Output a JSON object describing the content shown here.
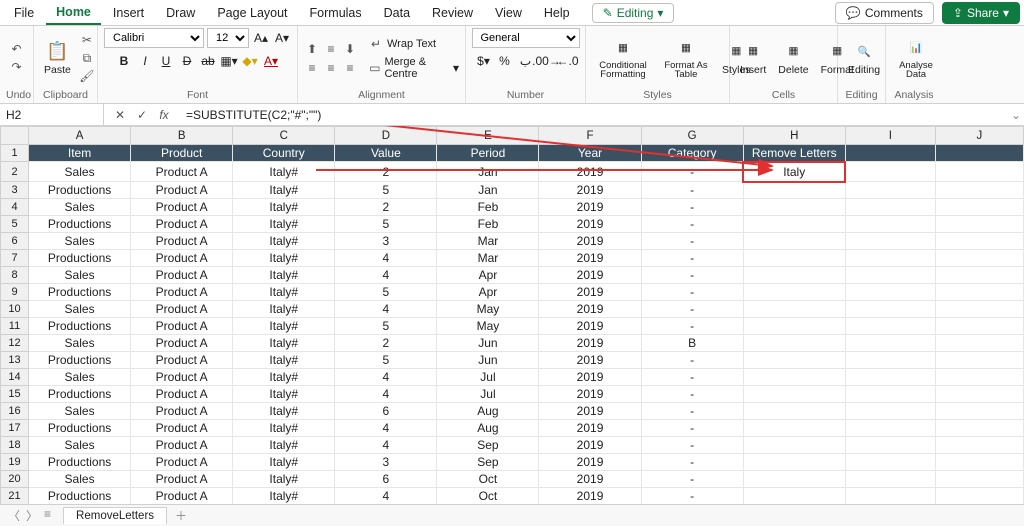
{
  "tabs": {
    "file": "File",
    "home": "Home",
    "insert": "Insert",
    "draw": "Draw",
    "layout": "Page Layout",
    "formulas": "Formulas",
    "data": "Data",
    "review": "Review",
    "view": "View",
    "help": "Help"
  },
  "editing_btn": "Editing",
  "comments_btn": "Comments",
  "share_btn": "Share",
  "ribbon": {
    "undo": "Undo",
    "paste": "Paste",
    "clipboard": "Clipboard",
    "font_name": "Calibri",
    "font_size": "12",
    "font_group": "Font",
    "wrap": "Wrap Text",
    "merge": "Merge & Centre",
    "align_group": "Alignment",
    "number_format": "General",
    "number_group": "Number",
    "cond": "Conditional Formatting",
    "fmt_tbl": "Format As Table",
    "styles": "Styles",
    "styles_group": "Styles",
    "insert": "Insert",
    "delete": "Delete",
    "format": "Format",
    "cells_group": "Cells",
    "editing": "Editing",
    "editing_group": "Editing",
    "analyse": "Analyse Data",
    "analysis_group": "Analysis"
  },
  "namebox": "H2",
  "formula": "=SUBSTITUTE(C2;\"#\";\"\")",
  "columns": [
    "A",
    "B",
    "C",
    "D",
    "E",
    "F",
    "G",
    "H",
    "I",
    "J"
  ],
  "headers": [
    "Item",
    "Product",
    "Country",
    "Value",
    "Period",
    "Year",
    "Category",
    "Remove Letters"
  ],
  "rows": [
    {
      "n": 1
    },
    {
      "n": 2,
      "c": [
        "Sales",
        "Product A",
        "Italy#",
        "2",
        "Jan",
        "2019",
        "-",
        "Italy"
      ]
    },
    {
      "n": 3,
      "c": [
        "Productions",
        "Product A",
        "Italy#",
        "5",
        "Jan",
        "2019",
        "-",
        ""
      ]
    },
    {
      "n": 4,
      "c": [
        "Sales",
        "Product A",
        "Italy#",
        "2",
        "Feb",
        "2019",
        "-",
        ""
      ]
    },
    {
      "n": 5,
      "c": [
        "Productions",
        "Product A",
        "Italy#",
        "5",
        "Feb",
        "2019",
        "-",
        ""
      ]
    },
    {
      "n": 6,
      "c": [
        "Sales",
        "Product A",
        "Italy#",
        "3",
        "Mar",
        "2019",
        "-",
        ""
      ]
    },
    {
      "n": 7,
      "c": [
        "Productions",
        "Product A",
        "Italy#",
        "4",
        "Mar",
        "2019",
        "-",
        ""
      ]
    },
    {
      "n": 8,
      "c": [
        "Sales",
        "Product A",
        "Italy#",
        "4",
        "Apr",
        "2019",
        "-",
        ""
      ]
    },
    {
      "n": 9,
      "c": [
        "Productions",
        "Product A",
        "Italy#",
        "5",
        "Apr",
        "2019",
        "-",
        ""
      ]
    },
    {
      "n": 10,
      "c": [
        "Sales",
        "Product A",
        "Italy#",
        "4",
        "May",
        "2019",
        "-",
        ""
      ]
    },
    {
      "n": 11,
      "c": [
        "Productions",
        "Product A",
        "Italy#",
        "5",
        "May",
        "2019",
        "-",
        ""
      ]
    },
    {
      "n": 12,
      "c": [
        "Sales",
        "Product A",
        "Italy#",
        "2",
        "Jun",
        "2019",
        "B",
        ""
      ]
    },
    {
      "n": 13,
      "c": [
        "Productions",
        "Product A",
        "Italy#",
        "5",
        "Jun",
        "2019",
        "-",
        ""
      ]
    },
    {
      "n": 14,
      "c": [
        "Sales",
        "Product A",
        "Italy#",
        "4",
        "Jul",
        "2019",
        "-",
        ""
      ]
    },
    {
      "n": 15,
      "c": [
        "Productions",
        "Product A",
        "Italy#",
        "4",
        "Jul",
        "2019",
        "-",
        ""
      ]
    },
    {
      "n": 16,
      "c": [
        "Sales",
        "Product A",
        "Italy#",
        "6",
        "Aug",
        "2019",
        "-",
        ""
      ]
    },
    {
      "n": 17,
      "c": [
        "Productions",
        "Product A",
        "Italy#",
        "4",
        "Aug",
        "2019",
        "-",
        ""
      ]
    },
    {
      "n": 18,
      "c": [
        "Sales",
        "Product A",
        "Italy#",
        "4",
        "Sep",
        "2019",
        "-",
        ""
      ]
    },
    {
      "n": 19,
      "c": [
        "Productions",
        "Product A",
        "Italy#",
        "3",
        "Sep",
        "2019",
        "-",
        ""
      ]
    },
    {
      "n": 20,
      "c": [
        "Sales",
        "Product A",
        "Italy#",
        "6",
        "Oct",
        "2019",
        "-",
        ""
      ]
    },
    {
      "n": 21,
      "c": [
        "Productions",
        "Product A",
        "Italy#",
        "4",
        "Oct",
        "2019",
        "-",
        ""
      ]
    }
  ],
  "sheet_tab": "RemoveLetters",
  "active_cell": "H2",
  "colors": {
    "accent": "#0f7b41",
    "header_bg": "#3b5161",
    "annotation": "#e03030"
  }
}
